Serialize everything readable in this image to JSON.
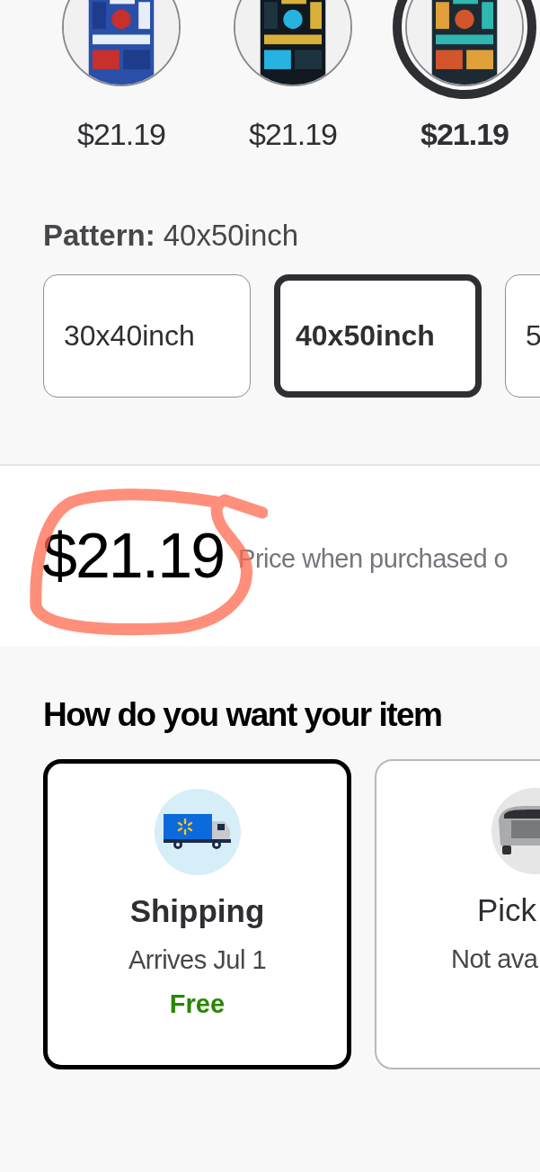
{
  "swatches": [
    {
      "price": "$21.19",
      "selected": false
    },
    {
      "price": "$21.19",
      "selected": false
    },
    {
      "price": "$21.19",
      "selected": true
    }
  ],
  "pattern": {
    "label": "Pattern:",
    "value": "40x50inch"
  },
  "sizes": [
    {
      "label": "30x40inch",
      "selected": false
    },
    {
      "label": "40x50inch",
      "selected": true
    },
    {
      "label": "5",
      "selected": false
    }
  ],
  "price": {
    "amount": "$21.19",
    "note": "Price when purchased o"
  },
  "fulfillment": {
    "heading": "How do you want your item",
    "options": [
      {
        "kind": "shipping",
        "title": "Shipping",
        "subtitle": "Arrives Jul 1",
        "note": "Free",
        "selected": true
      },
      {
        "kind": "pickup",
        "title": "Pick",
        "subtitle": "Not ava",
        "selected": false
      }
    ]
  }
}
